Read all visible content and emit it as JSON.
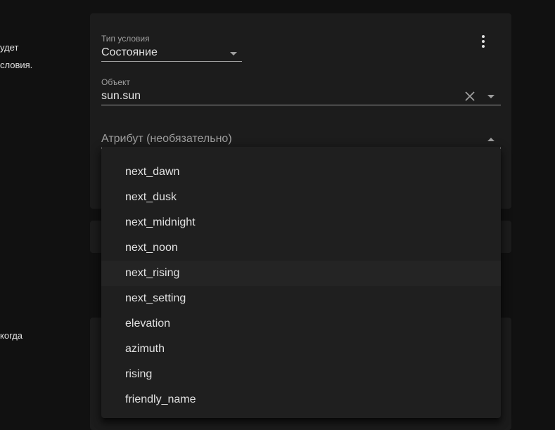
{
  "left_panel": {
    "text_line_1": "удет",
    "text_line_2": "словия.",
    "text_line_3": "когда"
  },
  "condition": {
    "type_label": "Тип условия",
    "type_value": "Состояние",
    "entity_label": "Объект",
    "entity_value": "sun.sun",
    "attribute_placeholder": "Атрибут (необязательно)"
  },
  "attribute_menu": {
    "items": [
      "next_dawn",
      "next_dusk",
      "next_midnight",
      "next_noon",
      "next_rising",
      "next_setting",
      "elevation",
      "azimuth",
      "rising",
      "friendly_name"
    ]
  },
  "icons": {
    "menu": "dots-vertical-icon",
    "clear": "close-icon",
    "dropdown": "menu-down-icon",
    "dropdown_open": "menu-up-icon"
  },
  "colors": {
    "background": "#111111",
    "card": "#1c1c1c",
    "menu": "#1f1f1f",
    "text": "#e1e1e1",
    "secondary_text": "#9e9e9e"
  }
}
